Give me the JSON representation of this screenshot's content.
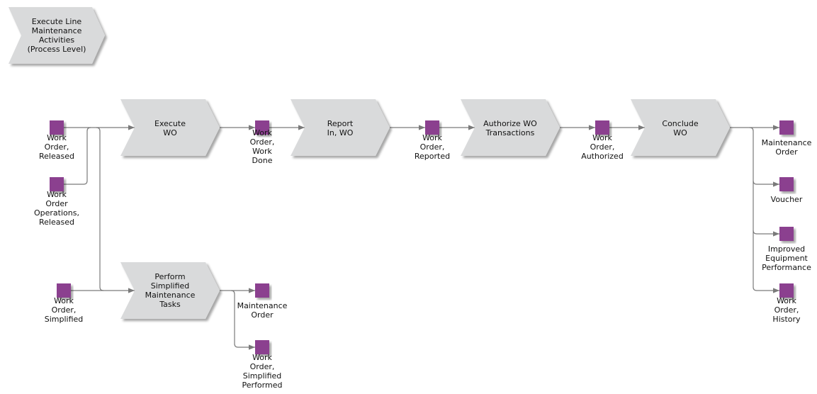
{
  "diagram": {
    "type": "EPC process flow",
    "header": {
      "label": "Execute Line\nMaintenance\nActivities\n(Process Level)"
    },
    "colors": {
      "function_fill": "#d9dadb",
      "function_shadow": "#b8b8b8",
      "object_fill": "#8b3f8f",
      "connector": "#7a7a7a"
    },
    "functions": [
      {
        "id": "f1",
        "label": "Execute\nWO"
      },
      {
        "id": "f2",
        "label": "Report\nIn, WO"
      },
      {
        "id": "f3",
        "label": "Authorize WO\nTransactions"
      },
      {
        "id": "f4",
        "label": "Conclude\nWO"
      },
      {
        "id": "f5",
        "label": "Perform\nSimplified\nMaintenance\nTasks"
      }
    ],
    "objects": [
      {
        "id": "o1",
        "label": "Work\nOrder,\nReleased"
      },
      {
        "id": "o2",
        "label": "Work\nOrder\nOperations,\nReleased"
      },
      {
        "id": "o3",
        "label": "Work\nOrder,\nSimplified"
      },
      {
        "id": "o4",
        "label": "Work\nOrder,\nWork\nDone"
      },
      {
        "id": "o5",
        "label": "Work\nOrder,\nReported"
      },
      {
        "id": "o6",
        "label": "Work\nOrder,\nAuthorized"
      },
      {
        "id": "o7",
        "label": "Maintenance\nOrder"
      },
      {
        "id": "o8",
        "label": "Voucher"
      },
      {
        "id": "o9",
        "label": "Improved\nEquipment\nPerformance"
      },
      {
        "id": "o10",
        "label": "Work\nOrder,\nHistory"
      },
      {
        "id": "o11",
        "label": "Maintenance\nOrder"
      },
      {
        "id": "o12",
        "label": "Work\nOrder,\nSimplified\nPerformed"
      }
    ],
    "edges": [
      {
        "from": "o1",
        "to": "f1"
      },
      {
        "from": "o2",
        "to": "f1"
      },
      {
        "from": "o1",
        "to": "f5"
      },
      {
        "from": "o3",
        "to": "f5"
      },
      {
        "from": "f1",
        "to": "o4"
      },
      {
        "from": "o4",
        "to": "f2"
      },
      {
        "from": "f2",
        "to": "o5"
      },
      {
        "from": "o5",
        "to": "f3"
      },
      {
        "from": "f3",
        "to": "o6"
      },
      {
        "from": "o6",
        "to": "f4"
      },
      {
        "from": "f4",
        "to": "o7"
      },
      {
        "from": "f4",
        "to": "o8"
      },
      {
        "from": "f4",
        "to": "o9"
      },
      {
        "from": "f4",
        "to": "o10"
      },
      {
        "from": "f5",
        "to": "o11"
      },
      {
        "from": "f5",
        "to": "o12"
      }
    ]
  }
}
